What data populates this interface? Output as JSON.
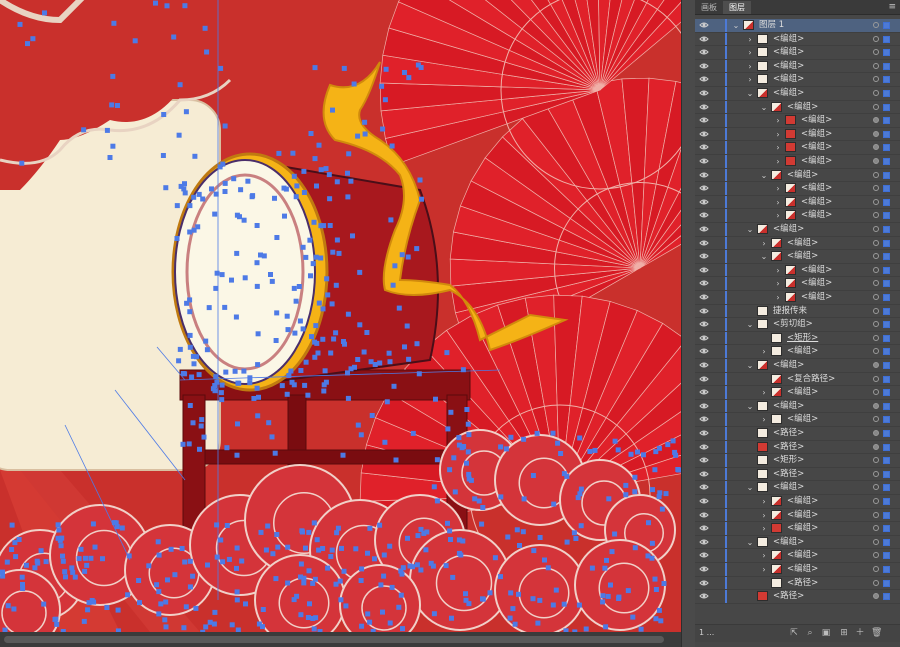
{
  "panel": {
    "tabs": [
      "画板",
      "图层"
    ],
    "active_tab": "图层",
    "footer_count": "1 ...",
    "footer_icons": [
      "export-icon",
      "search-icon",
      "clipping-mask-icon",
      "new-sublayer-icon",
      "new-layer-icon",
      "trash-icon"
    ]
  },
  "layers": [
    {
      "indent": 0,
      "twirl": "open",
      "label": "图层 1",
      "thumb": "art",
      "selected": true,
      "target_fill": false,
      "sq": true
    },
    {
      "indent": 1,
      "twirl": "closed",
      "label": "<编组>",
      "thumb": "plain",
      "target_fill": false,
      "sq": true
    },
    {
      "indent": 1,
      "twirl": "closed",
      "label": "<编组>",
      "thumb": "plain",
      "target_fill": false,
      "sq": true
    },
    {
      "indent": 1,
      "twirl": "closed",
      "label": "<编组>",
      "thumb": "plain",
      "target_fill": false,
      "sq": true
    },
    {
      "indent": 1,
      "twirl": "closed",
      "label": "<编组>",
      "thumb": "plain",
      "target_fill": false,
      "sq": true
    },
    {
      "indent": 1,
      "twirl": "open",
      "label": "<编组>",
      "thumb": "art",
      "target_fill": false,
      "sq": true
    },
    {
      "indent": 2,
      "twirl": "open",
      "label": "<编组>",
      "thumb": "art",
      "target_fill": false,
      "sq": true
    },
    {
      "indent": 3,
      "twirl": "closed",
      "label": "<编组>",
      "thumb": "red",
      "target_fill": true,
      "sq": true
    },
    {
      "indent": 3,
      "twirl": "closed",
      "label": "<编组>",
      "thumb": "red",
      "target_fill": true,
      "sq": true
    },
    {
      "indent": 3,
      "twirl": "closed",
      "label": "<编组>",
      "thumb": "red",
      "target_fill": true,
      "sq": true
    },
    {
      "indent": 3,
      "twirl": "closed",
      "label": "<编组>",
      "thumb": "red",
      "target_fill": true,
      "sq": true
    },
    {
      "indent": 2,
      "twirl": "open",
      "label": "<编组>",
      "thumb": "art",
      "target_fill": false,
      "sq": true
    },
    {
      "indent": 3,
      "twirl": "closed",
      "label": "<编组>",
      "thumb": "art",
      "target_fill": false,
      "sq": true
    },
    {
      "indent": 3,
      "twirl": "closed",
      "label": "<编组>",
      "thumb": "art",
      "target_fill": false,
      "sq": true
    },
    {
      "indent": 3,
      "twirl": "closed",
      "label": "<编组>",
      "thumb": "art",
      "target_fill": false,
      "sq": true
    },
    {
      "indent": 1,
      "twirl": "open",
      "label": "<编组>",
      "thumb": "art",
      "target_fill": false,
      "sq": true
    },
    {
      "indent": 2,
      "twirl": "closed",
      "label": "<编组>",
      "thumb": "art",
      "target_fill": false,
      "sq": true
    },
    {
      "indent": 2,
      "twirl": "open",
      "label": "<编组>",
      "thumb": "art",
      "target_fill": false,
      "sq": true
    },
    {
      "indent": 3,
      "twirl": "closed",
      "label": "<编组>",
      "thumb": "art",
      "target_fill": false,
      "sq": true
    },
    {
      "indent": 3,
      "twirl": "closed",
      "label": "<编组>",
      "thumb": "art",
      "target_fill": false,
      "sq": true
    },
    {
      "indent": 3,
      "twirl": "closed",
      "label": "<编组>",
      "thumb": "art",
      "target_fill": false,
      "sq": true
    },
    {
      "indent": 1,
      "twirl": "none",
      "label": "捷报传来",
      "thumb": "plain",
      "target_fill": false,
      "sq": true
    },
    {
      "indent": 1,
      "twirl": "open",
      "label": "<剪切组>",
      "thumb": "plain",
      "target_fill": false,
      "sq": true
    },
    {
      "indent": 2,
      "twirl": "none",
      "label": "<矩形>",
      "thumb": "plain",
      "underline": true,
      "target_fill": false,
      "sq": true
    },
    {
      "indent": 2,
      "twirl": "closed",
      "label": "<编组>",
      "thumb": "plain",
      "target_fill": false,
      "sq": true
    },
    {
      "indent": 1,
      "twirl": "open",
      "label": "<编组>",
      "thumb": "art",
      "target_fill": true,
      "sq": true
    },
    {
      "indent": 2,
      "twirl": "none",
      "label": "<复合路径>",
      "thumb": "art",
      "target_fill": false,
      "sq": true
    },
    {
      "indent": 2,
      "twirl": "closed",
      "label": "<编组>",
      "thumb": "art",
      "target_fill": false,
      "sq": true
    },
    {
      "indent": 1,
      "twirl": "open",
      "label": "<编组>",
      "thumb": "plain",
      "target_fill": true,
      "sq": true
    },
    {
      "indent": 2,
      "twirl": "closed",
      "label": "<编组>",
      "thumb": "plain",
      "target_fill": false,
      "sq": true
    },
    {
      "indent": 1,
      "twirl": "none",
      "label": "<路径>",
      "thumb": "plain",
      "target_fill": true,
      "sq": true
    },
    {
      "indent": 1,
      "twirl": "none",
      "label": "<路径>",
      "thumb": "red",
      "target_fill": true,
      "sq": true
    },
    {
      "indent": 1,
      "twirl": "none",
      "label": "<矩形>",
      "thumb": "plain",
      "target_fill": false,
      "sq": true
    },
    {
      "indent": 1,
      "twirl": "none",
      "label": "<路径>",
      "thumb": "plain",
      "target_fill": false,
      "sq": true
    },
    {
      "indent": 1,
      "twirl": "open",
      "label": "<编组>",
      "thumb": "plain",
      "target_fill": false,
      "sq": true
    },
    {
      "indent": 2,
      "twirl": "closed",
      "label": "<编组>",
      "thumb": "art",
      "target_fill": false,
      "sq": true
    },
    {
      "indent": 2,
      "twirl": "closed",
      "label": "<编组>",
      "thumb": "art",
      "target_fill": false,
      "sq": true
    },
    {
      "indent": 2,
      "twirl": "closed",
      "label": "<编组>",
      "thumb": "red",
      "target_fill": false,
      "sq": true
    },
    {
      "indent": 1,
      "twirl": "open",
      "label": "<编组>",
      "thumb": "plain",
      "target_fill": false,
      "sq": true
    },
    {
      "indent": 2,
      "twirl": "closed",
      "label": "<编组>",
      "thumb": "art",
      "target_fill": false,
      "sq": true
    },
    {
      "indent": 2,
      "twirl": "closed",
      "label": "<编组>",
      "thumb": "art",
      "target_fill": false,
      "sq": true
    },
    {
      "indent": 2,
      "twirl": "none",
      "label": "<路径>",
      "thumb": "plain",
      "target_fill": false,
      "sq": true
    },
    {
      "indent": 1,
      "twirl": "none",
      "label": "<路径>",
      "thumb": "red",
      "target_fill": true,
      "sq": true
    }
  ],
  "colors": {
    "canvas_bg": "#c9302c",
    "cream": "#f6ecd4",
    "fan_red": "#e0212a",
    "gold": "#f5b316",
    "anchor_blue": "#4d7ae6",
    "drum_red": "#a8181e"
  }
}
